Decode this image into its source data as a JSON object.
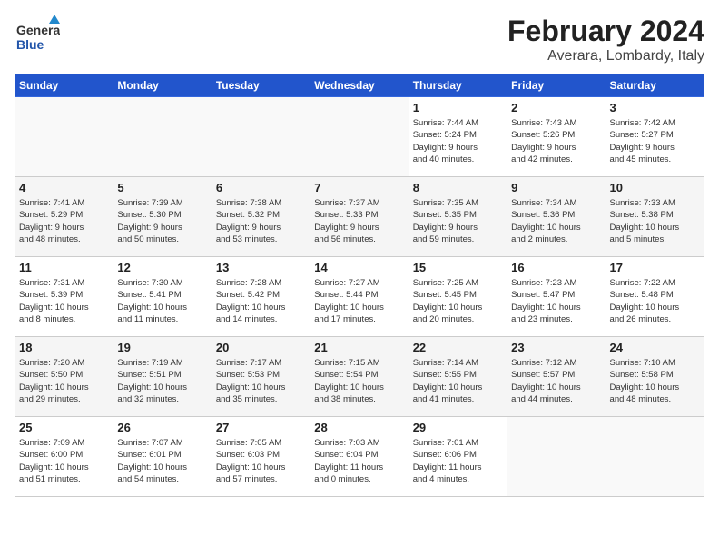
{
  "header": {
    "logo_line1": "General",
    "logo_line2": "Blue",
    "month_year": "February 2024",
    "location": "Averara, Lombardy, Italy"
  },
  "days_of_week": [
    "Sunday",
    "Monday",
    "Tuesday",
    "Wednesday",
    "Thursday",
    "Friday",
    "Saturday"
  ],
  "weeks": [
    [
      {
        "day": "",
        "info": ""
      },
      {
        "day": "",
        "info": ""
      },
      {
        "day": "",
        "info": ""
      },
      {
        "day": "",
        "info": ""
      },
      {
        "day": "1",
        "info": "Sunrise: 7:44 AM\nSunset: 5:24 PM\nDaylight: 9 hours\nand 40 minutes."
      },
      {
        "day": "2",
        "info": "Sunrise: 7:43 AM\nSunset: 5:26 PM\nDaylight: 9 hours\nand 42 minutes."
      },
      {
        "day": "3",
        "info": "Sunrise: 7:42 AM\nSunset: 5:27 PM\nDaylight: 9 hours\nand 45 minutes."
      }
    ],
    [
      {
        "day": "4",
        "info": "Sunrise: 7:41 AM\nSunset: 5:29 PM\nDaylight: 9 hours\nand 48 minutes."
      },
      {
        "day": "5",
        "info": "Sunrise: 7:39 AM\nSunset: 5:30 PM\nDaylight: 9 hours\nand 50 minutes."
      },
      {
        "day": "6",
        "info": "Sunrise: 7:38 AM\nSunset: 5:32 PM\nDaylight: 9 hours\nand 53 minutes."
      },
      {
        "day": "7",
        "info": "Sunrise: 7:37 AM\nSunset: 5:33 PM\nDaylight: 9 hours\nand 56 minutes."
      },
      {
        "day": "8",
        "info": "Sunrise: 7:35 AM\nSunset: 5:35 PM\nDaylight: 9 hours\nand 59 minutes."
      },
      {
        "day": "9",
        "info": "Sunrise: 7:34 AM\nSunset: 5:36 PM\nDaylight: 10 hours\nand 2 minutes."
      },
      {
        "day": "10",
        "info": "Sunrise: 7:33 AM\nSunset: 5:38 PM\nDaylight: 10 hours\nand 5 minutes."
      }
    ],
    [
      {
        "day": "11",
        "info": "Sunrise: 7:31 AM\nSunset: 5:39 PM\nDaylight: 10 hours\nand 8 minutes."
      },
      {
        "day": "12",
        "info": "Sunrise: 7:30 AM\nSunset: 5:41 PM\nDaylight: 10 hours\nand 11 minutes."
      },
      {
        "day": "13",
        "info": "Sunrise: 7:28 AM\nSunset: 5:42 PM\nDaylight: 10 hours\nand 14 minutes."
      },
      {
        "day": "14",
        "info": "Sunrise: 7:27 AM\nSunset: 5:44 PM\nDaylight: 10 hours\nand 17 minutes."
      },
      {
        "day": "15",
        "info": "Sunrise: 7:25 AM\nSunset: 5:45 PM\nDaylight: 10 hours\nand 20 minutes."
      },
      {
        "day": "16",
        "info": "Sunrise: 7:23 AM\nSunset: 5:47 PM\nDaylight: 10 hours\nand 23 minutes."
      },
      {
        "day": "17",
        "info": "Sunrise: 7:22 AM\nSunset: 5:48 PM\nDaylight: 10 hours\nand 26 minutes."
      }
    ],
    [
      {
        "day": "18",
        "info": "Sunrise: 7:20 AM\nSunset: 5:50 PM\nDaylight: 10 hours\nand 29 minutes."
      },
      {
        "day": "19",
        "info": "Sunrise: 7:19 AM\nSunset: 5:51 PM\nDaylight: 10 hours\nand 32 minutes."
      },
      {
        "day": "20",
        "info": "Sunrise: 7:17 AM\nSunset: 5:53 PM\nDaylight: 10 hours\nand 35 minutes."
      },
      {
        "day": "21",
        "info": "Sunrise: 7:15 AM\nSunset: 5:54 PM\nDaylight: 10 hours\nand 38 minutes."
      },
      {
        "day": "22",
        "info": "Sunrise: 7:14 AM\nSunset: 5:55 PM\nDaylight: 10 hours\nand 41 minutes."
      },
      {
        "day": "23",
        "info": "Sunrise: 7:12 AM\nSunset: 5:57 PM\nDaylight: 10 hours\nand 44 minutes."
      },
      {
        "day": "24",
        "info": "Sunrise: 7:10 AM\nSunset: 5:58 PM\nDaylight: 10 hours\nand 48 minutes."
      }
    ],
    [
      {
        "day": "25",
        "info": "Sunrise: 7:09 AM\nSunset: 6:00 PM\nDaylight: 10 hours\nand 51 minutes."
      },
      {
        "day": "26",
        "info": "Sunrise: 7:07 AM\nSunset: 6:01 PM\nDaylight: 10 hours\nand 54 minutes."
      },
      {
        "day": "27",
        "info": "Sunrise: 7:05 AM\nSunset: 6:03 PM\nDaylight: 10 hours\nand 57 minutes."
      },
      {
        "day": "28",
        "info": "Sunrise: 7:03 AM\nSunset: 6:04 PM\nDaylight: 11 hours\nand 0 minutes."
      },
      {
        "day": "29",
        "info": "Sunrise: 7:01 AM\nSunset: 6:06 PM\nDaylight: 11 hours\nand 4 minutes."
      },
      {
        "day": "",
        "info": ""
      },
      {
        "day": "",
        "info": ""
      }
    ]
  ]
}
